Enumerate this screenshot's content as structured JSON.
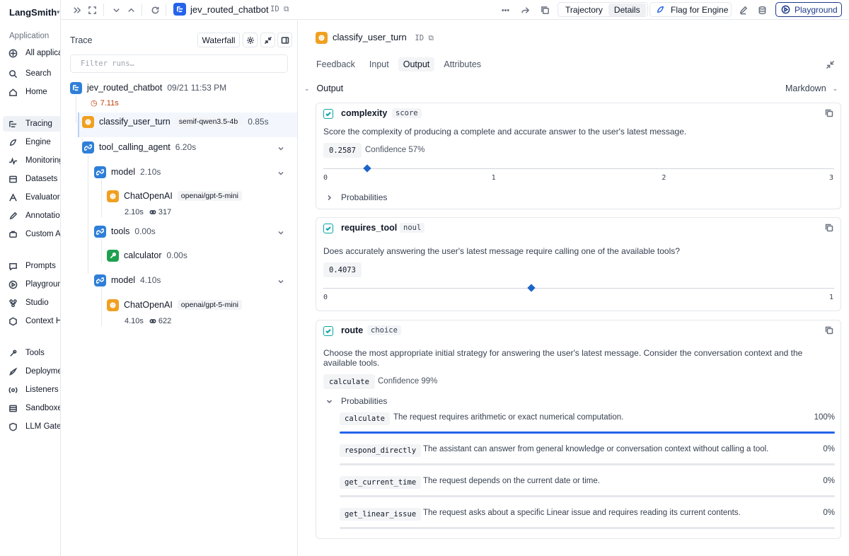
{
  "app": {
    "brand": "LangSmith"
  },
  "nav": {
    "section_application": "Application",
    "items_top": [
      {
        "label": "All applications",
        "icon": "grid-icon"
      }
    ],
    "items_main": [
      {
        "label": "Search",
        "icon": "search-icon"
      },
      {
        "label": "Home",
        "icon": "home-icon"
      },
      {
        "label": "Tracing",
        "icon": "tracing-icon",
        "active": true
      },
      {
        "label": "Engine",
        "icon": "engine-icon"
      },
      {
        "label": "Monitoring",
        "icon": "monitoring-icon"
      },
      {
        "label": "Datasets & Experiments",
        "icon": "datasets-icon"
      },
      {
        "label": "Evaluators",
        "icon": "evaluators-icon"
      },
      {
        "label": "Annotation Queues",
        "icon": "annotation-icon"
      },
      {
        "label": "Custom Agents",
        "icon": "custom-agents-icon"
      }
    ],
    "items_build": [
      {
        "label": "Prompts",
        "icon": "prompts-icon"
      },
      {
        "label": "Playground",
        "icon": "playground-icon"
      },
      {
        "label": "Studio",
        "icon": "studio-icon"
      },
      {
        "label": "Context Hub",
        "icon": "context-hub-icon"
      }
    ],
    "items_deploy": [
      {
        "label": "Tools",
        "icon": "tools-icon"
      },
      {
        "label": "Deployments",
        "icon": "deployments-icon"
      },
      {
        "label": "Listeners",
        "icon": "listeners-icon"
      },
      {
        "label": "Sandboxes",
        "icon": "sandboxes-icon"
      },
      {
        "label": "LLM Gateway",
        "icon": "gateway-icon"
      }
    ]
  },
  "topbar": {
    "run_title": "jev_routed_chatbot",
    "id_label": "ID",
    "view_tabs": [
      {
        "label": "Trajectory",
        "active": false
      },
      {
        "label": "Details",
        "active": true
      }
    ],
    "flag_label": "Flag for Engine",
    "playground_label": "Playground"
  },
  "trace": {
    "title": "Trace",
    "waterfall_label": "Waterfall",
    "filter_placeholder": "Filter runs…",
    "root": {
      "name": "jev_routed_chatbot",
      "time": "09/21 11:53 PM",
      "latency": "7.11s"
    },
    "nodes": [
      {
        "name": "classify_user_turn",
        "tag": "semif-qwen3.5-4b",
        "latency": "0.85s"
      },
      {
        "name": "tool_calling_agent",
        "latency": "6.20s"
      },
      {
        "name": "model",
        "latency": "2.10s"
      },
      {
        "name": "ChatOpenAI",
        "tag": "openai/gpt-5-mini",
        "latency": "2.10s",
        "tokens": "317"
      },
      {
        "name": "tools",
        "latency": "0.00s"
      },
      {
        "name": "calculator",
        "latency": "0.00s"
      },
      {
        "name": "model",
        "latency": "4.10s"
      },
      {
        "name": "ChatOpenAI",
        "tag": "openai/gpt-5-mini",
        "latency": "4.10s",
        "tokens": "622"
      }
    ]
  },
  "detail": {
    "title": "classify_user_turn",
    "id_label": "ID",
    "tabs": [
      {
        "label": "Feedback",
        "active": false
      },
      {
        "label": "Input",
        "active": false
      },
      {
        "label": "Output",
        "active": true
      },
      {
        "label": "Attributes",
        "active": false
      }
    ],
    "output_label": "Output",
    "format_label": "Markdown",
    "cards": {
      "complexity": {
        "name": "complexity",
        "type": "score",
        "description": "Score the complexity of producing a complete and accurate answer to the user's latest message.",
        "value": "0.2587",
        "confidence": "Confidence 57%",
        "axis_min": 0,
        "axis_max": 3,
        "ticks": [
          "0",
          "1",
          "2",
          "3"
        ],
        "marker_value": 0.2587,
        "prob_label": "Probabilities"
      },
      "requires_tool": {
        "name": "requires_tool",
        "type": "noul",
        "description": "Does accurately answering the user's latest message require calling one of the available tools?",
        "value": "0.4073",
        "axis_min": 0,
        "axis_max": 1,
        "ticks": [
          "0",
          "1"
        ],
        "marker_value": 0.4073
      },
      "route": {
        "name": "route",
        "type": "choice",
        "description": "Choose the most appropriate initial strategy for answering the user's latest message. Consider the conversation context and the available tools.",
        "value": "calculate",
        "confidence": "Confidence 99%",
        "prob_label": "Probabilities",
        "options": [
          {
            "name": "calculate",
            "desc": "The request requires arithmetic or exact numerical computation.",
            "pct": "100%",
            "frac": 1.0
          },
          {
            "name": "respond_directly",
            "desc": "The assistant can answer from general knowledge or conversation context without calling a tool.",
            "pct": "0%",
            "frac": 0.0
          },
          {
            "name": "get_current_time",
            "desc": "The request depends on the current date or time.",
            "pct": "0%",
            "frac": 0.0
          },
          {
            "name": "get_linear_issue",
            "desc": "The request asks about a specific Linear issue and requires reading its current contents.",
            "pct": "0%",
            "frac": 0.0
          }
        ]
      }
    }
  },
  "colors": {
    "accent_blue": "#2563eb",
    "run_orange": "#f0a020",
    "tool_green": "#1fa050",
    "feedback_teal": "#0aa5a5"
  }
}
